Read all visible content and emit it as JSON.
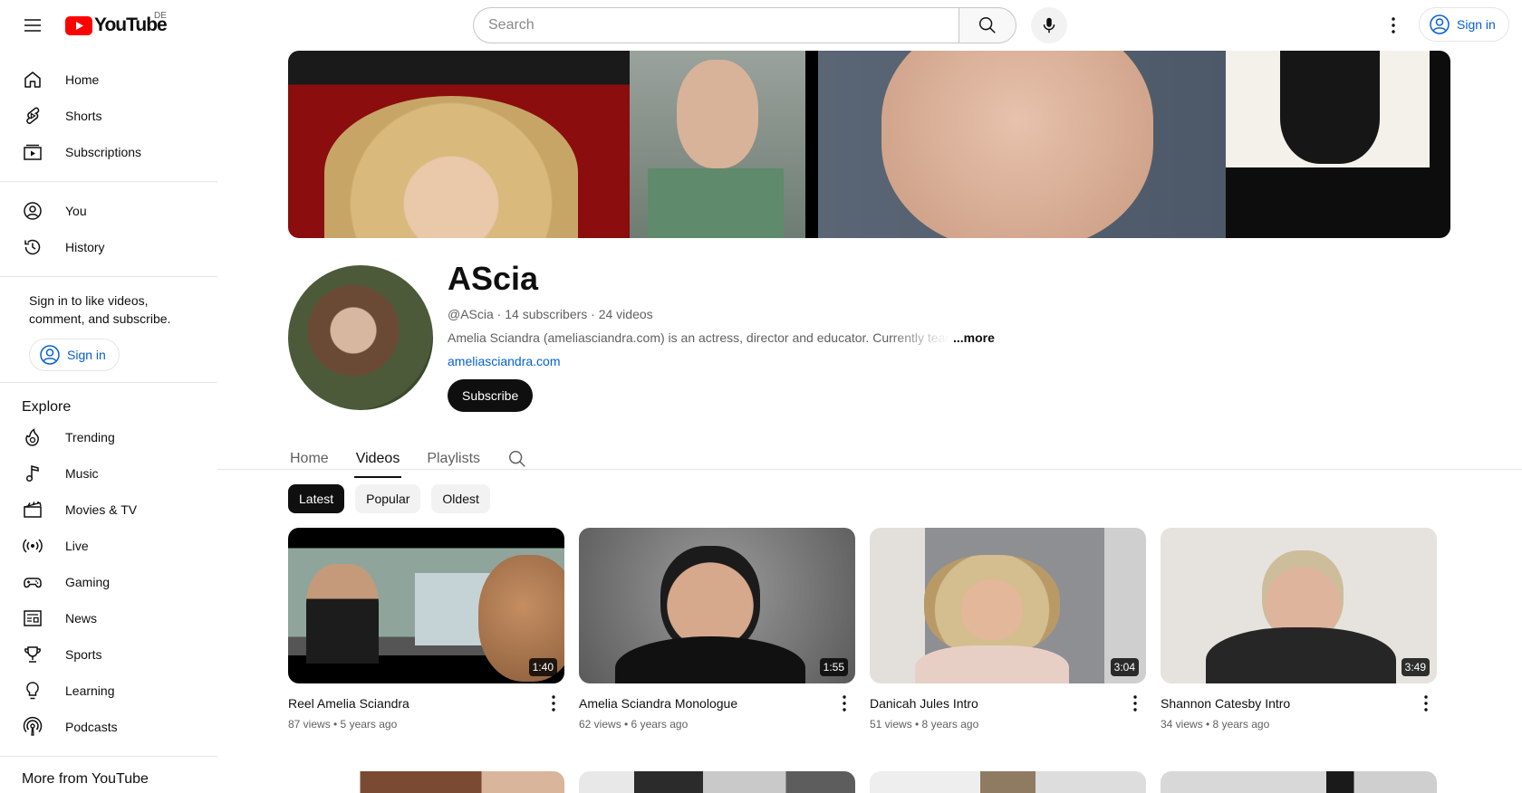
{
  "header": {
    "logo_text": "YouTube",
    "country": "DE",
    "search_placeholder": "Search",
    "sign_in": "Sign in"
  },
  "sidebar": {
    "main_items": [
      {
        "label": "Home",
        "icon": "home-icon"
      },
      {
        "label": "Shorts",
        "icon": "shorts-icon"
      },
      {
        "label": "Subscriptions",
        "icon": "subscriptions-icon"
      }
    ],
    "you_items": [
      {
        "label": "You",
        "icon": "you-icon"
      },
      {
        "label": "History",
        "icon": "history-icon"
      }
    ],
    "signin_message": "Sign in to like videos, comment, and subscribe.",
    "signin_button": "Sign in",
    "explore_heading": "Explore",
    "explore_items": [
      {
        "label": "Trending",
        "icon": "trending-icon"
      },
      {
        "label": "Music",
        "icon": "music-icon"
      },
      {
        "label": "Movies & TV",
        "icon": "movies-icon"
      },
      {
        "label": "Live",
        "icon": "live-icon"
      },
      {
        "label": "Gaming",
        "icon": "gaming-icon"
      },
      {
        "label": "News",
        "icon": "news-icon"
      },
      {
        "label": "Sports",
        "icon": "sports-icon"
      },
      {
        "label": "Learning",
        "icon": "learning-icon"
      },
      {
        "label": "Podcasts",
        "icon": "podcasts-icon"
      }
    ],
    "more_heading": "More from YouTube"
  },
  "channel": {
    "name": "AScia",
    "meta": "@AScia · 14 subscribers · 24 videos",
    "description": "Amelia Sciandra (ameliasciandra.com) is an actress, director and educator. Currently teaching",
    "more": "...more",
    "link": "ameliasciandra.com",
    "subscribe": "Subscribe"
  },
  "tabs": [
    "Home",
    "Videos",
    "Playlists"
  ],
  "chips": [
    "Latest",
    "Popular",
    "Oldest"
  ],
  "videos": [
    {
      "title": "Reel Amelia Sciandra",
      "meta": "87 views • 5 years ago",
      "duration": "1:40"
    },
    {
      "title": "Amelia Sciandra Monologue",
      "meta": "62 views • 6 years ago",
      "duration": "1:55"
    },
    {
      "title": "Danicah Jules Intro",
      "meta": "51 views • 8 years ago",
      "duration": "3:04"
    },
    {
      "title": "Shannon Catesby Intro",
      "meta": "34 views • 8 years ago",
      "duration": "3:49"
    }
  ],
  "colors": {
    "brand_red": "#ff0000",
    "link_blue": "#065fd4",
    "text_primary": "#0f0f0f",
    "text_secondary": "#606060"
  }
}
